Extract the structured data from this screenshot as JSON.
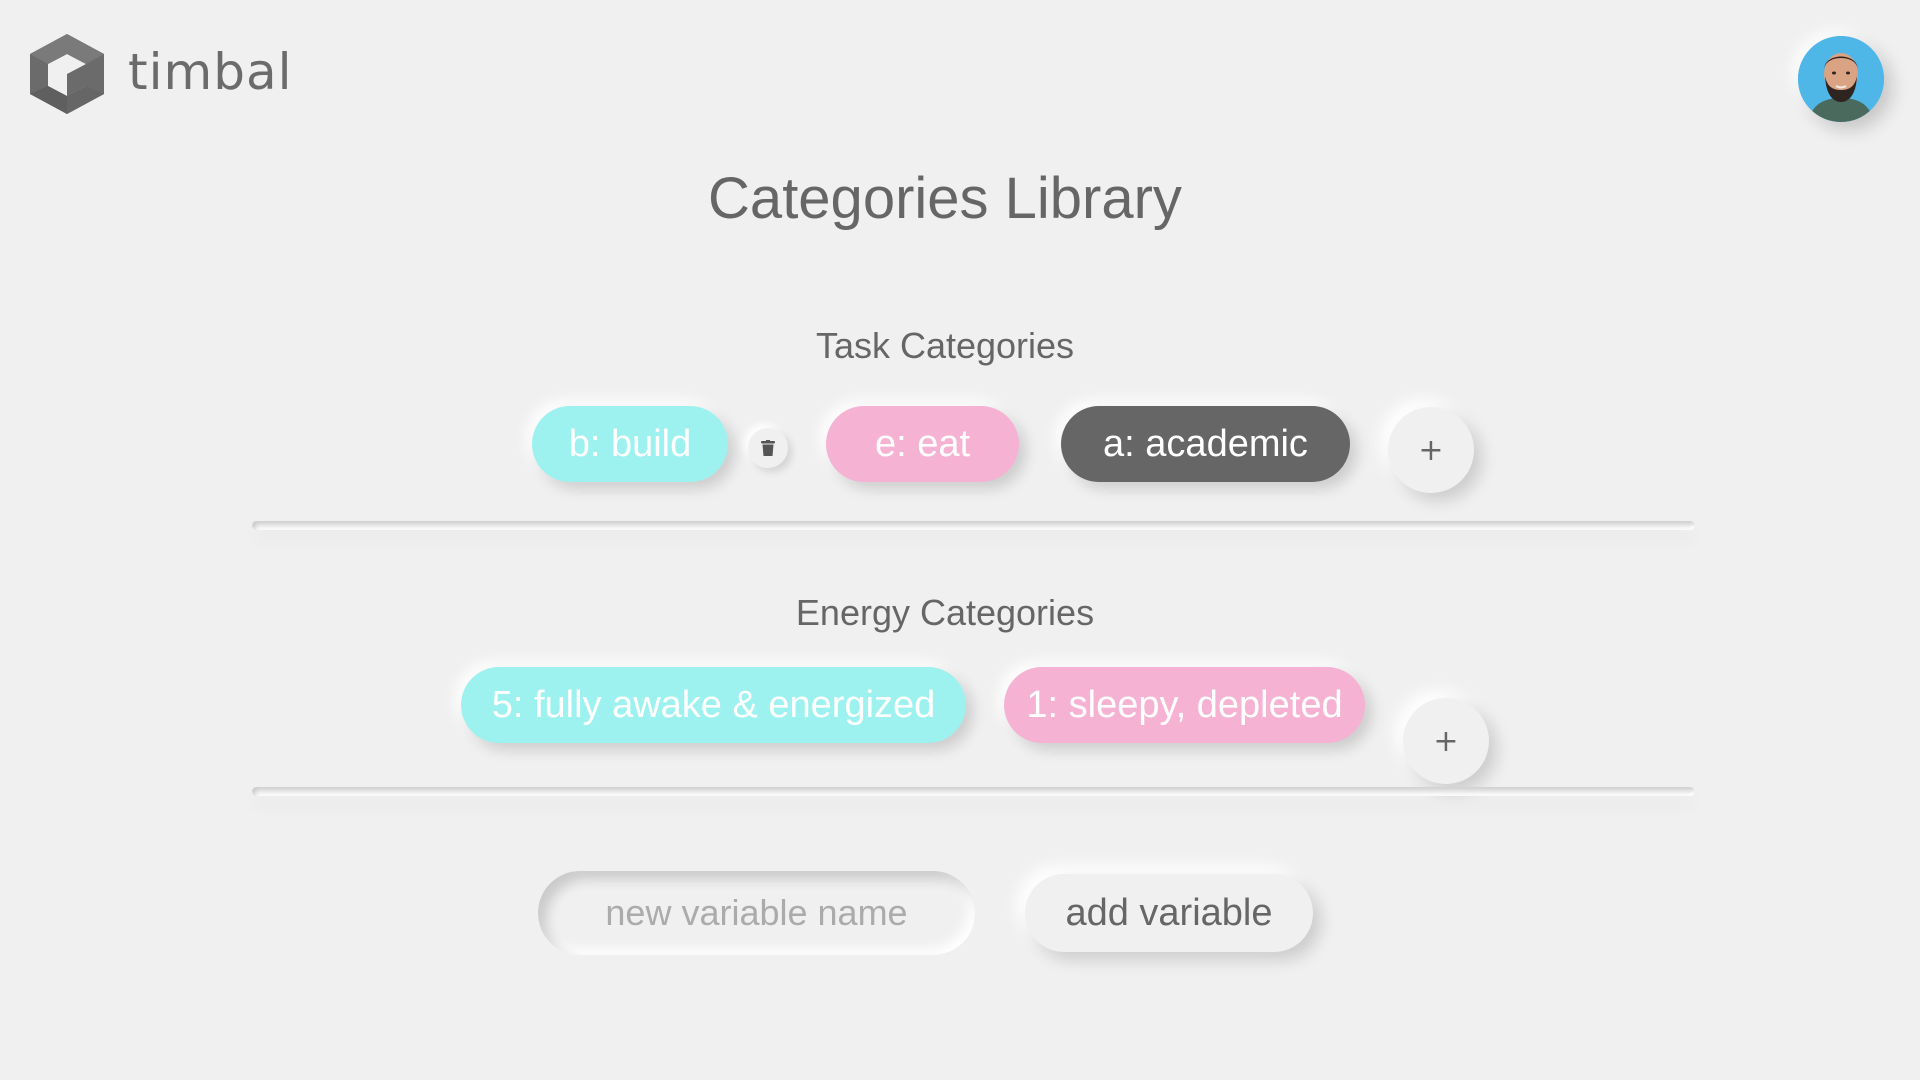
{
  "header": {
    "logo_text": "timbal",
    "logo_icon": "hexagon-cube-icon",
    "avatar_icon": "user-avatar"
  },
  "page": {
    "title": "Categories Library"
  },
  "task_categories": {
    "title": "Task Categories",
    "items": [
      {
        "label": "b: build",
        "color": "#9df2f0"
      },
      {
        "label": "e: eat",
        "color": "#f5b2d3"
      },
      {
        "label": "a: academic",
        "color": "#666666"
      }
    ],
    "delete_icon": "trash-icon",
    "add_label": "+"
  },
  "energy_categories": {
    "title": "Energy Categories",
    "items": [
      {
        "label": "5: fully awake & energized",
        "color": "#9df2f0"
      },
      {
        "label": "1: sleepy, depleted",
        "color": "#f5b2d3"
      }
    ],
    "add_label": "+"
  },
  "new_variable": {
    "input_value": "",
    "placeholder": "new variable name",
    "button_label": "add variable"
  },
  "colors": {
    "background": "#f0f0f0",
    "text": "#666666",
    "cyan": "#9df2f0",
    "pink": "#f5b2d3",
    "dark": "#666666"
  }
}
